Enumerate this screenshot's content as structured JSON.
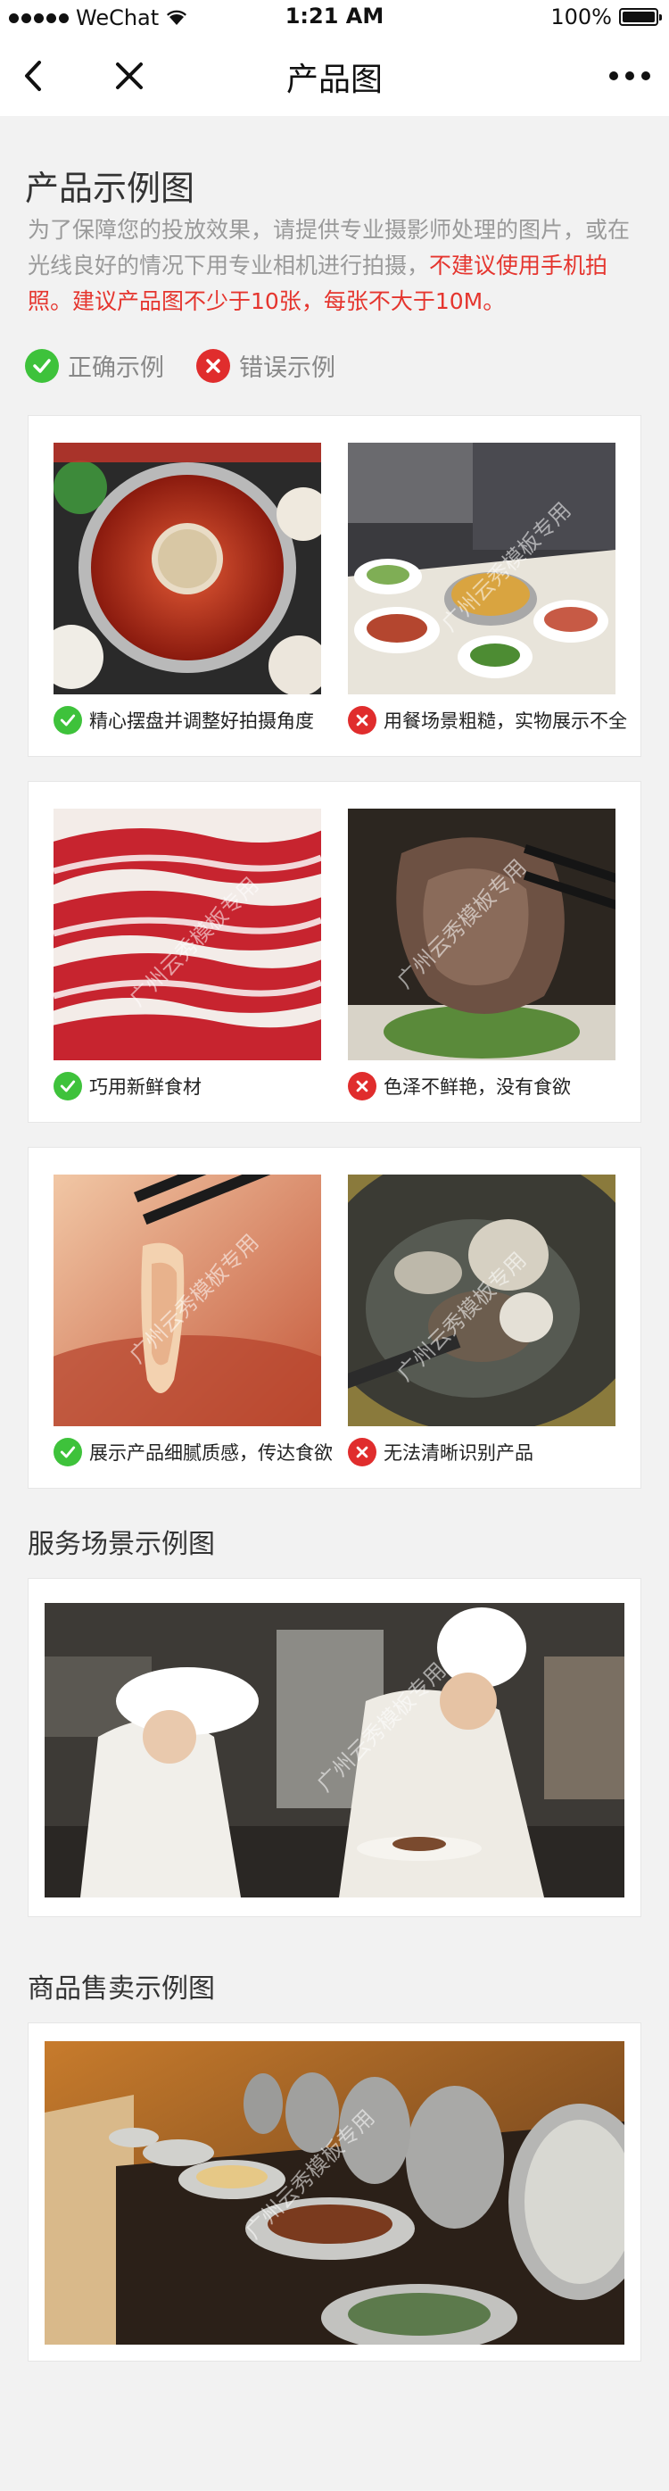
{
  "status_bar": {
    "carrier": "WeChat",
    "time": "1:21 AM",
    "battery": "100%",
    "battery_level": 1.0
  },
  "nav": {
    "title": "产品图",
    "back_icon": "chevron-left-icon",
    "close_icon": "close-icon",
    "more_icon": "more-dots-icon"
  },
  "page": {
    "heading": "产品示例图",
    "intro_gray": "为了保障您的投放效果，请提供专业摄影师处理的图片，或在光线良好的情况下用专业相机进行拍摄，",
    "intro_red": "不建议使用手机拍照。建议产品图不少于10张，每张不大于10M。",
    "legend_correct": "正确示例",
    "legend_wrong": "错误示例"
  },
  "colors": {
    "accent_red": "#e5352e",
    "ok_green": "#3ec23b",
    "bad_red": "#e02d2d"
  },
  "examples": [
    {
      "good_caption": "精心摆盘并调整好拍摄角度",
      "bad_caption": "用餐场景粗糙，实物展示不全"
    },
    {
      "good_caption": "巧用新鲜食材",
      "bad_caption": "色泽不鲜艳，没有食欲"
    },
    {
      "good_caption": "展示产品细腻质感，传达食欲",
      "bad_caption": "无法清晰识别产品"
    }
  ],
  "service": {
    "title": "服务场景示例图"
  },
  "sales": {
    "title": "商品售卖示例图"
  },
  "watermark": "广州云秀模板专用"
}
